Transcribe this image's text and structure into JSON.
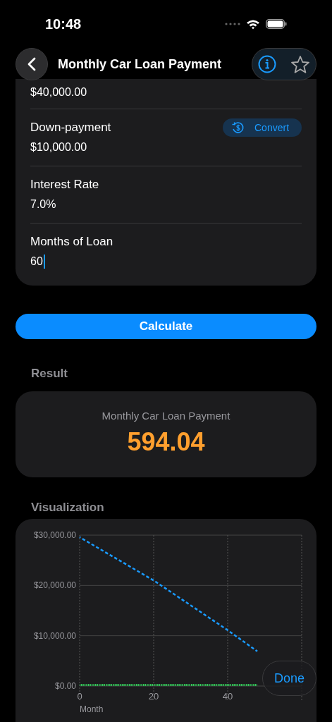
{
  "status_bar": {
    "time": "10:48"
  },
  "nav": {
    "title": "Monthly Car Loan Payment"
  },
  "inputs": [
    {
      "value": "$40,000.00"
    },
    {
      "label": "Down-payment",
      "value": "$10,000.00",
      "action": "Convert"
    },
    {
      "label": "Interest Rate",
      "value": "7.0%"
    },
    {
      "label": "Months of Loan",
      "value": "60",
      "focused": true
    }
  ],
  "calculate_button": "Calculate",
  "result": {
    "heading": "Result",
    "label": "Monthly Car Loan Payment",
    "value": "594.04"
  },
  "visualization": {
    "heading": "Visualization",
    "chart_data": {
      "type": "line",
      "xlabel": "Month",
      "x": [
        0,
        20,
        40,
        48
      ],
      "xlim": [
        0,
        60
      ],
      "grid": true,
      "ylim": [
        0,
        30000
      ],
      "xticks": [
        0,
        20,
        40
      ],
      "yticks": [
        {
          "value": 0,
          "label": "$0.00"
        },
        {
          "value": 10000,
          "label": "$10,000.00"
        },
        {
          "value": 20000,
          "label": "$20,000.00"
        },
        {
          "value": 30000,
          "label": "$30,000.00"
        }
      ],
      "series": [
        {
          "color": "#1a9bff",
          "line_style": "dashed",
          "values": [
            29600,
            21000,
            11100,
            6900
          ]
        },
        {
          "color": "#34c759",
          "line_style": "dotted",
          "values": [
            200,
            200,
            200,
            200
          ]
        }
      ]
    }
  },
  "done_button": "Done"
}
